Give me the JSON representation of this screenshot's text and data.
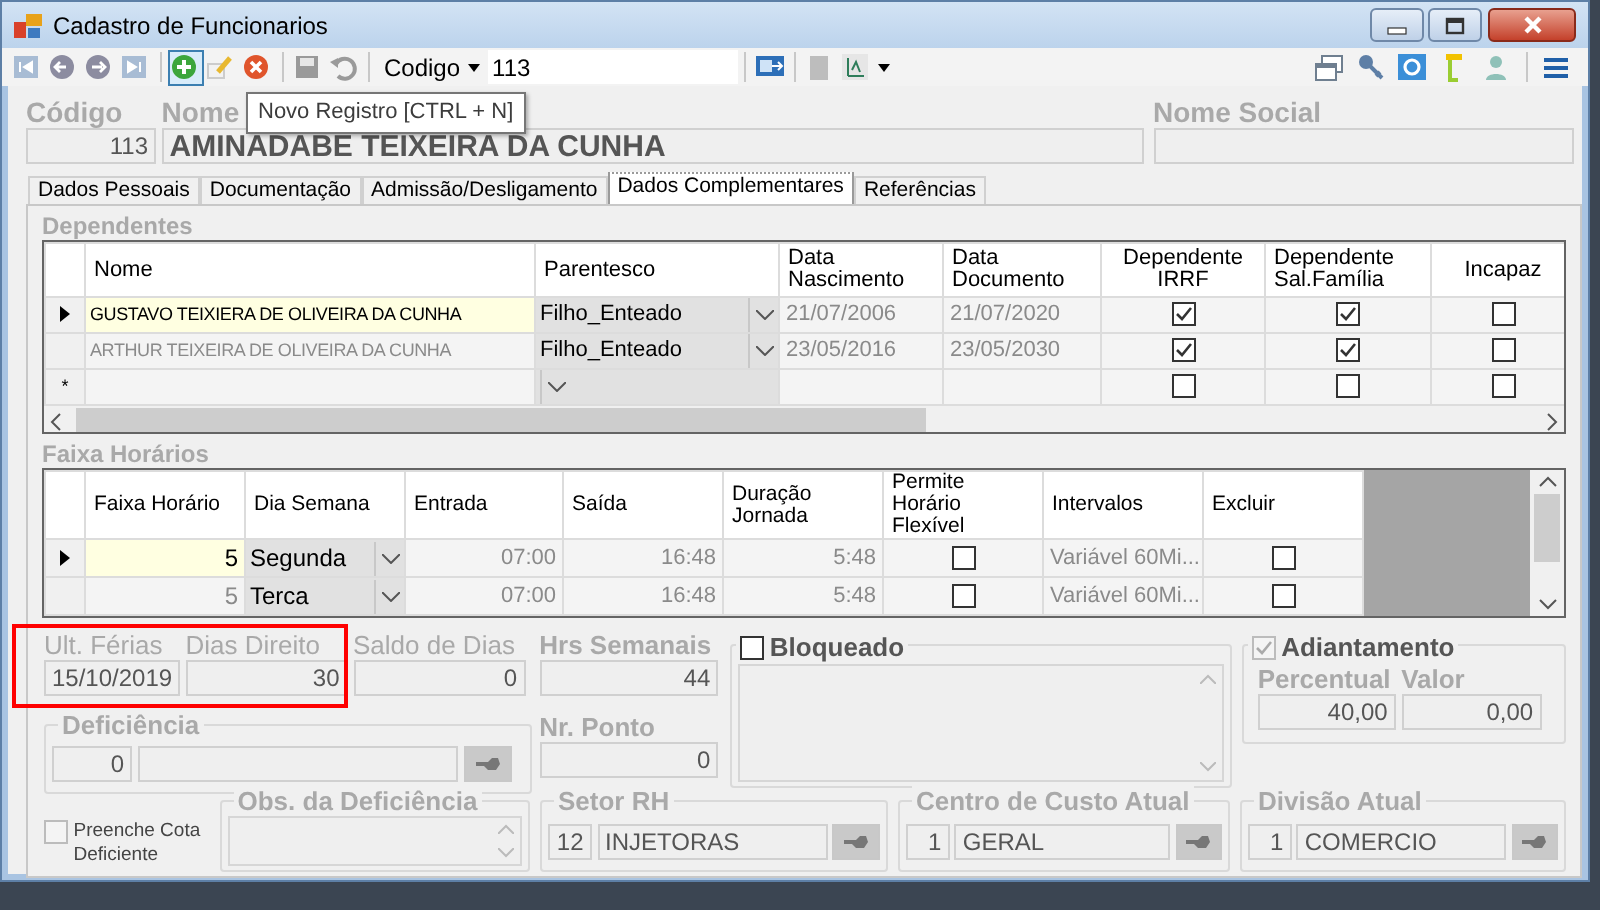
{
  "window": {
    "title": "Cadastro de Funcionarios"
  },
  "toolbar": {
    "left": [
      {
        "kind": "first",
        "hovered": false
      },
      {
        "kind": "prev",
        "hovered": false
      },
      {
        "kind": "next",
        "hovered": false
      },
      {
        "kind": "last",
        "hovered": false
      },
      {
        "kind": "separator"
      },
      {
        "kind": "new",
        "hovered": true
      },
      {
        "kind": "edit",
        "hovered": false
      },
      {
        "kind": "delete",
        "hovered": false
      },
      {
        "kind": "separator"
      },
      {
        "kind": "save",
        "hovered": false
      },
      {
        "kind": "undo",
        "hovered": false
      },
      {
        "kind": "separator"
      }
    ],
    "code_selector": {
      "label": "Codigo",
      "value": "113"
    },
    "middle": [
      {
        "kind": "separator"
      },
      {
        "kind": "screen"
      },
      {
        "kind": "separator"
      },
      {
        "kind": "doc"
      },
      {
        "kind": "chart"
      }
    ],
    "right": [
      {
        "kind": "windows"
      },
      {
        "kind": "key"
      },
      {
        "kind": "refresh"
      },
      {
        "kind": "bookmark"
      },
      {
        "kind": "person"
      },
      {
        "kind": "separator"
      },
      {
        "kind": "list"
      }
    ]
  },
  "tooltip": {
    "text": "Novo Registro [CTRL + N]"
  },
  "header": {
    "codigo": {
      "label": "Código",
      "value": "113"
    },
    "nome": {
      "label": "Nome",
      "value": "AMINADABE TEIXEIRA DA CUNHA"
    },
    "nome_social": {
      "label": "Nome Social"
    }
  },
  "tabs": [
    {
      "label": "Dados Pessoais",
      "selected": false
    },
    {
      "label": "Documentação",
      "selected": false
    },
    {
      "label": "Admissão/Desligamento",
      "selected": false
    },
    {
      "label": "Dados Complementares",
      "selected": true
    },
    {
      "label": "Referências",
      "selected": false
    }
  ],
  "dependentes": {
    "title": "Dependentes",
    "columns": [
      "Nome",
      "Parentesco",
      "Data Nascimento",
      "Data Documento",
      "Dependente IRRF",
      "Dependente Sal.Família",
      "Incapaz"
    ],
    "rows": [
      {
        "nome": "GUSTAVO TEIXIERA DE OLIVEIRA DA CUNHA",
        "parentesco": "Filho_Enteado",
        "data_nascimento": "21/07/2006",
        "data_documento": "21/07/2020",
        "irrf": true,
        "sal_familia": true,
        "incapaz": false,
        "selected": true
      },
      {
        "nome": "ARTHUR TEIXEIRA DE OLIVEIRA DA CUNHA",
        "parentesco": "Filho_Enteado",
        "data_nascimento": "23/05/2016",
        "data_documento": "23/05/2030",
        "irrf": true,
        "sal_familia": true,
        "incapaz": false,
        "selected": false
      }
    ],
    "new_row": {
      "marker": "*",
      "irrf": false,
      "sal_familia": false,
      "incapaz": false
    }
  },
  "faixa_horarios": {
    "title": "Faixa Horários",
    "columns": [
      "Faixa Horário",
      "Dia Semana",
      "Entrada",
      "Saída",
      "Duração Jornada",
      "Permite Horário Flexível",
      "Intervalos",
      "Excluir"
    ],
    "rows": [
      {
        "faixa": "5",
        "dia": "Segunda",
        "entrada": "07:00",
        "saida": "16:48",
        "duracao": "5:48",
        "flexivel": false,
        "intervalos": "Variável 60Mi...",
        "excluir": false,
        "selected": true
      },
      {
        "faixa": "5",
        "dia": "Terca",
        "entrada": "07:00",
        "saida": "16:48",
        "duracao": "5:48",
        "flexivel": false,
        "intervalos": "Variável 60Mi...",
        "excluir": false,
        "selected": false
      }
    ]
  },
  "ferias": [
    {
      "label": "Ult. Férias",
      "value": "15/10/2019"
    },
    {
      "label": "Dias Direito",
      "value": "30"
    },
    {
      "label": "Saldo de Dias",
      "value": "0"
    }
  ],
  "hrs_semanais": {
    "label": "Hrs Semanais",
    "value": "44"
  },
  "nr_ponto": {
    "label": "Nr. Ponto",
    "value": "0"
  },
  "deficiencia": {
    "title": "Deficiência",
    "code": "0"
  },
  "bloqueado": {
    "label": "Bloqueado",
    "checked": false,
    "disabled": false
  },
  "adiantamento": {
    "label": "Adiantamento",
    "checked": true,
    "disabled": true,
    "percentual": {
      "label": "Percentual",
      "value": "40,00"
    },
    "valor": {
      "label": "Valor",
      "value": "0,00"
    }
  },
  "preenche_cota": {
    "label": "Preenche Cota Deficiente",
    "checked": false
  },
  "obs_deficiencia": {
    "title": "Obs. da Deficiência"
  },
  "lookups": [
    {
      "title": "Setor RH",
      "code": "12",
      "value": "INJETORAS"
    },
    {
      "title": "Centro de Custo Atual",
      "code": "1",
      "value": "GERAL"
    },
    {
      "title": "Divisão Atual",
      "code": "1",
      "value": "COMERCIO"
    }
  ],
  "annotation": {
    "kind": "highlight"
  }
}
